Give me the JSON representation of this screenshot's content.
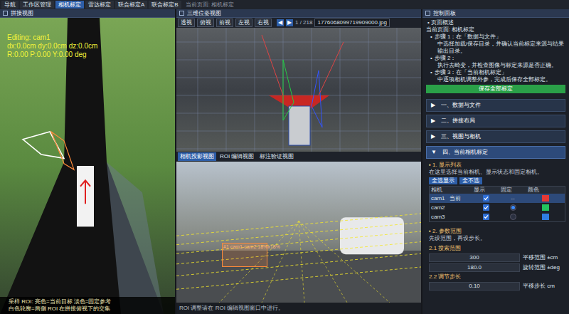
{
  "topbar": {
    "tabs": [
      {
        "label": "导航",
        "selected": false
      },
      {
        "label": "工作区管理",
        "selected": false
      },
      {
        "label": "相机标定",
        "selected": true
      },
      {
        "label": "雷达标定",
        "selected": false
      },
      {
        "label": "联合标定A",
        "selected": false
      },
      {
        "label": "联合标定B",
        "selected": false
      }
    ],
    "page": "当前页面: 相机标定"
  },
  "stitch": {
    "title": "拼接视图",
    "editing": "Editing: cam1",
    "offset": "dx:0.0cm dy:0.0cm dz:0.0cm",
    "rotation": "R:0.00 P:0.00 Y:0.00 deg",
    "notes": [
      "采样 ROI: 亮色=当前目标  淡色=固定参考",
      "白色轮廓=两侧 ROI 在拼接俯视下的交集"
    ]
  },
  "pose": {
    "title": "三维位姿视图",
    "views": [
      "透视",
      "俯视",
      "前视",
      "左视",
      "右视"
    ],
    "prev": "◀",
    "next": "▶",
    "counter": "1 / 218",
    "file": "1776068099719909000.jpg"
  },
  "projection": {
    "tabs": [
      {
        "label": "相机投影视图",
        "selected": true
      },
      {
        "label": "ROI 编辑视图",
        "selected": false
      },
      {
        "label": "标注验证视图",
        "selected": false
      }
    ],
    "roi_label": "#1 cam1-cam2 18%x18%",
    "hint": "ROI 调整请在 ROI 编辑视图窗口中进行。"
  },
  "panel": {
    "title": "控制面板",
    "overview": {
      "title": "页面概述",
      "current": "当前页面: 相机标定",
      "steps": [
        {
          "title": "步骤 1：在「数据与文件」",
          "text": "中选择加载/保存目录，并确认当前标定来源与结果输出目录。"
        },
        {
          "title": "步骤 2：",
          "text": "执行去畸变，并检查图像与标定来源是否正确。"
        },
        {
          "title": "步骤 3：在「当前相机标定」",
          "text": "中逐项相机调整外参，完成后保存全部标定。"
        }
      ],
      "save": "保存全部标定"
    },
    "sections": [
      {
        "icon": "▶",
        "label": "一、数据与文件",
        "expanded": false
      },
      {
        "icon": "▶",
        "label": "二、拼接布局",
        "expanded": false
      },
      {
        "icon": "▶",
        "label": "三、视图与相机",
        "expanded": false
      },
      {
        "icon": "▼",
        "label": "四、当前相机标定",
        "expanded": true
      }
    ],
    "display": {
      "title": "1. 显示列表",
      "desc": "在这里选择当前相机、显示状态和固定相机。",
      "buttons": [
        "全选显示",
        "全不选"
      ],
      "columns": [
        "相机",
        "显示",
        "固定",
        "颜色"
      ],
      "rows": [
        {
          "name": "cam1",
          "tag": "当前",
          "kind": "current",
          "fixed_text": "--",
          "shown": true,
          "fixed": false,
          "selected": true,
          "color": "#e53935"
        },
        {
          "name": "cam2",
          "tag": "",
          "kind": "radio",
          "fixed_text": "",
          "shown": true,
          "fixed": true,
          "selected": false,
          "color": "#22c55e"
        },
        {
          "name": "cam3",
          "tag": "",
          "kind": "radio",
          "fixed_text": "",
          "shown": true,
          "fixed": false,
          "selected": false,
          "color": "#2f7de1"
        }
      ]
    },
    "params": {
      "title": "2. 参数范围",
      "desc": "先设范围，再设步长。",
      "search_title": "2.1 搜索范围",
      "search": [
        {
          "value": "300",
          "label": "平移范围 ±cm"
        },
        {
          "value": "180.0",
          "label": "旋转范围 ±deg"
        }
      ],
      "step_title": "2.2 调节步长",
      "step": [
        {
          "value": "0.10",
          "label": "平移步长 cm"
        }
      ]
    }
  }
}
